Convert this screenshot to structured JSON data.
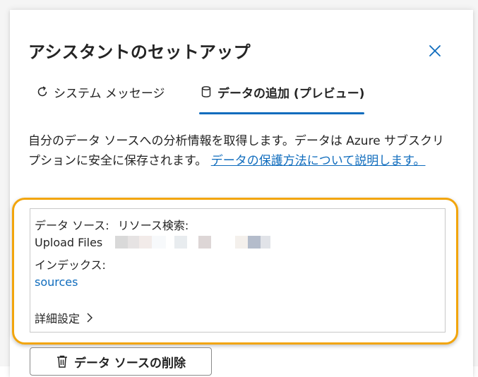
{
  "dialog": {
    "title": "アシスタントのセットアップ"
  },
  "tabs": [
    {
      "label": "システム メッセージ",
      "icon": "refresh-icon"
    },
    {
      "label": "データの追加 (プレビュー)",
      "icon": "database-icon",
      "active": true
    }
  ],
  "description": {
    "text": "自分のデータ ソースへの分析情報を取得します。データは Azure サブスクリプションに安全に保存されます。",
    "link": "データの保護方法について説明します。"
  },
  "data_source": {
    "source_label": "データ ソース:",
    "source_value": "リソース検索:",
    "upload_label": "Upload Files",
    "index_label": "インデックス:",
    "index_value": "sources",
    "advanced_label": "詳細設定"
  },
  "buttons": {
    "delete_label": "データ ソースの削除"
  },
  "colors": {
    "accent": "#0f6cbd",
    "highlight": "#f2a50c"
  }
}
